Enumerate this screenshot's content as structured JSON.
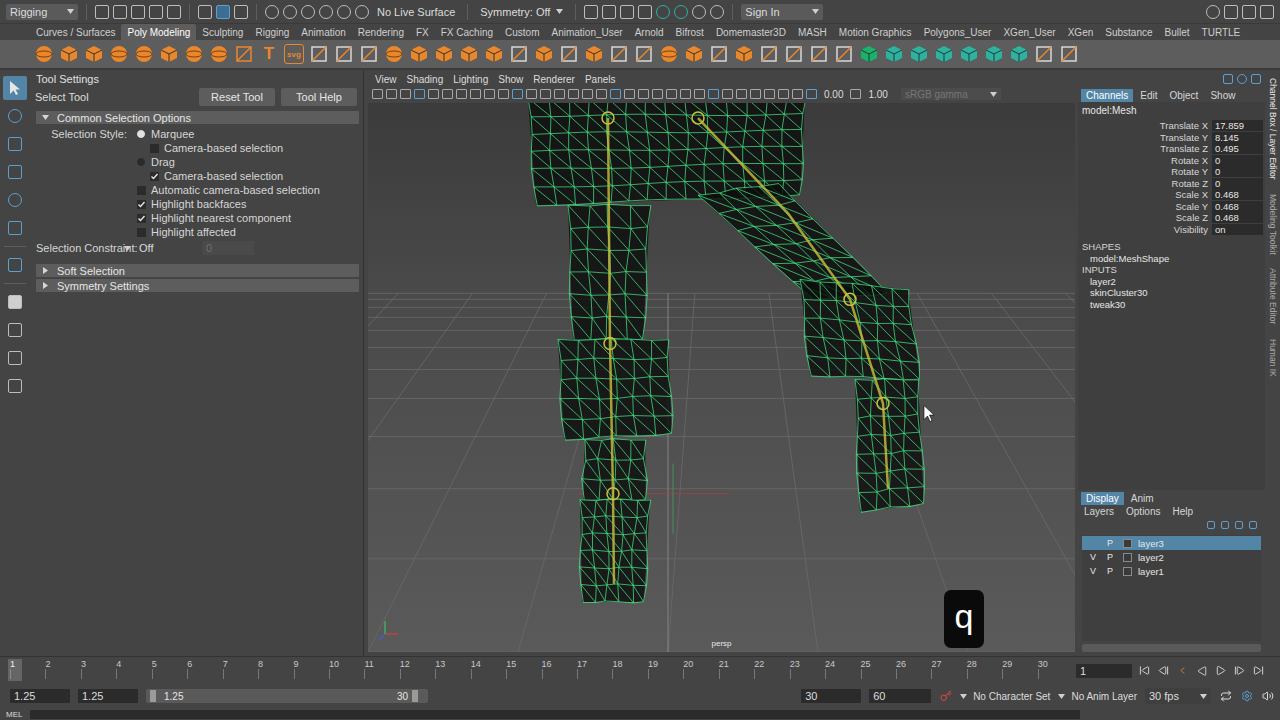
{
  "workspace": {
    "label": "Rigging"
  },
  "status_line": {
    "live_surface": "No Live Surface",
    "symmetry": "Symmetry: Off",
    "sign_in": "Sign In"
  },
  "shelf_tabs": [
    {
      "label": "Curves / Surfaces",
      "selected": false
    },
    {
      "label": "Poly Modeling",
      "selected": true
    },
    {
      "label": "Sculpting",
      "selected": false
    },
    {
      "label": "Rigging",
      "selected": false
    },
    {
      "label": "Animation",
      "selected": false
    },
    {
      "label": "Rendering",
      "selected": false
    },
    {
      "label": "FX",
      "selected": false
    },
    {
      "label": "FX Caching",
      "selected": false
    },
    {
      "label": "Custom",
      "selected": false
    },
    {
      "label": "Animation_User",
      "selected": false
    },
    {
      "label": "Arnold",
      "selected": false
    },
    {
      "label": "Bifrost",
      "selected": false
    },
    {
      "label": "Domemaster3D",
      "selected": false
    },
    {
      "label": "MASH",
      "selected": false
    },
    {
      "label": "Motion Graphics",
      "selected": false
    },
    {
      "label": "Polygons_User",
      "selected": false
    },
    {
      "label": "XGen_User",
      "selected": false
    },
    {
      "label": "XGen",
      "selected": false
    },
    {
      "label": "Substance",
      "selected": false
    },
    {
      "label": "Bullet",
      "selected": false
    },
    {
      "label": "TURTLE",
      "selected": false
    }
  ],
  "shelf_icons": [
    {
      "kind": "sphere",
      "color": "#e8872c"
    },
    {
      "kind": "cube",
      "color": "#e8872c"
    },
    {
      "kind": "cube",
      "color": "#e8872c"
    },
    {
      "kind": "sphere",
      "color": "#e8872c"
    },
    {
      "kind": "sphere",
      "color": "#e8872c"
    },
    {
      "kind": "cube",
      "color": "#e8872c"
    },
    {
      "kind": "sphere",
      "color": "#e8872c"
    },
    {
      "kind": "sphere",
      "color": "#e8872c"
    },
    {
      "kind": "tool",
      "color": "#e8872c"
    },
    {
      "kind": "text",
      "text": "T",
      "color": "#e8872c"
    },
    {
      "kind": "text",
      "text": "svg",
      "color": "#e8872c"
    },
    {
      "kind": "tool",
      "color": "#d8d8d8"
    },
    {
      "kind": "tool",
      "color": "#d8d8d8"
    },
    {
      "kind": "tool",
      "color": "#d8d8d8"
    },
    {
      "kind": "sphere",
      "color": "#e8872c"
    },
    {
      "kind": "cube",
      "color": "#e8872c"
    },
    {
      "kind": "cube",
      "color": "#e8872c"
    },
    {
      "kind": "cube",
      "color": "#e8872c"
    },
    {
      "kind": "cube",
      "color": "#e8872c"
    },
    {
      "kind": "tool",
      "color": "#d8d8d8"
    },
    {
      "kind": "cube",
      "color": "#e8872c"
    },
    {
      "kind": "tool",
      "color": "#d8d8d8"
    },
    {
      "kind": "cube",
      "color": "#e8872c"
    },
    {
      "kind": "tool",
      "color": "#d8d8d8"
    },
    {
      "kind": "tool",
      "color": "#d8d8d8"
    },
    {
      "kind": "sphere",
      "color": "#e8872c"
    },
    {
      "kind": "cube",
      "color": "#e8872c"
    },
    {
      "kind": "tool",
      "color": "#d8d8d8"
    },
    {
      "kind": "cube",
      "color": "#e8872c"
    },
    {
      "kind": "tool",
      "color": "#d8d8d8"
    },
    {
      "kind": "tool",
      "color": "#d8d8d8"
    },
    {
      "kind": "tool",
      "color": "#d8d8d8"
    },
    {
      "kind": "tool",
      "color": "#d8d8d8"
    },
    {
      "kind": "cube",
      "color": "#18b36b"
    },
    {
      "kind": "cube",
      "color": "#2bb3a0"
    },
    {
      "kind": "cube",
      "color": "#2bb3a0"
    },
    {
      "kind": "cube",
      "color": "#2bb3a0"
    },
    {
      "kind": "cube",
      "color": "#2bb3a0"
    },
    {
      "kind": "cube",
      "color": "#2bb3a0"
    },
    {
      "kind": "cube",
      "color": "#2bb3a0"
    },
    {
      "kind": "tool",
      "color": "#d8d8d8"
    },
    {
      "kind": "tool",
      "color": "#d8d8d8"
    }
  ],
  "tool_settings": {
    "title": "Tool Settings",
    "tool_name": "Select Tool",
    "buttons": [
      "Reset Tool",
      "Tool Help"
    ],
    "sections": [
      {
        "label": "Common Selection Options",
        "expanded": true
      },
      {
        "label": "Soft Selection",
        "expanded": false
      },
      {
        "label": "Symmetry Settings",
        "expanded": false
      }
    ],
    "selection_style_label": "Selection Style:",
    "options": [
      {
        "kind": "radio",
        "label": "Marquee",
        "checked": true
      },
      {
        "kind": "subcheck",
        "label": "Camera-based selection",
        "checked": false
      },
      {
        "kind": "radio",
        "label": "Drag",
        "checked": false
      },
      {
        "kind": "subcheck",
        "label": "Camera-based selection",
        "checked": true
      },
      {
        "kind": "check",
        "label": "Automatic camera-based selection",
        "checked": false
      },
      {
        "kind": "check",
        "label": "Highlight backfaces",
        "checked": true
      },
      {
        "kind": "check",
        "label": "Highlight nearest component",
        "checked": true
      },
      {
        "kind": "check",
        "label": "Highlight affected",
        "checked": false
      }
    ],
    "constraint": {
      "label": "Selection Constraint:",
      "value": "Off",
      "number": "0",
      "number_disabled": true
    }
  },
  "viewport": {
    "menus": [
      "View",
      "Shading",
      "Lighting",
      "Show",
      "Renderer",
      "Panels"
    ],
    "exposure": "0.00",
    "gamma": "1.00",
    "color_space": "sRGB gamma",
    "camera": "persp"
  },
  "key_overlay": "q",
  "channel_box": {
    "tabs": [
      {
        "label": "Channels",
        "selected": true
      },
      {
        "label": "Edit",
        "selected": false
      },
      {
        "label": "Object",
        "selected": false
      },
      {
        "label": "Show",
        "selected": false
      }
    ],
    "object": "model:Mesh",
    "attributes": [
      {
        "label": "Translate X",
        "value": "17.859"
      },
      {
        "label": "Translate Y",
        "value": "8.145"
      },
      {
        "label": "Translate Z",
        "value": "0.495"
      },
      {
        "label": "Rotate X",
        "value": "0"
      },
      {
        "label": "Rotate Y",
        "value": "0"
      },
      {
        "label": "Rotate Z",
        "value": "0"
      },
      {
        "label": "Scale X",
        "value": "0.468"
      },
      {
        "label": "Scale Y",
        "value": "0.468"
      },
      {
        "label": "Scale Z",
        "value": "0.468"
      },
      {
        "label": "Visibility",
        "value": "on"
      }
    ],
    "shapes_label": "SHAPES",
    "shapes": [
      "model:MeshShape"
    ],
    "inputs_label": "INPUTS",
    "inputs": [
      "layer2",
      "skinCluster30",
      "tweak30"
    ]
  },
  "side_tabs": [
    {
      "label": "Channel Box / Layer Editor",
      "selected": true
    },
    {
      "label": "Modeling Toolkit",
      "selected": false
    },
    {
      "label": "Attribute Editor",
      "selected": false
    },
    {
      "label": "Human IK",
      "selected": false
    }
  ],
  "layer_editor": {
    "tabs": [
      {
        "label": "Display",
        "selected": true
      },
      {
        "label": "Anim",
        "selected": false
      }
    ],
    "menus": [
      "Layers",
      "Options",
      "Help"
    ],
    "visible_mark": "V",
    "playback_mark": "P",
    "layers": [
      {
        "name": "layer3",
        "visible": false,
        "playback": true,
        "selected": true
      },
      {
        "name": "layer2",
        "visible": true,
        "playback": true,
        "selected": false
      },
      {
        "name": "layer1",
        "visible": true,
        "playback": true,
        "selected": false
      }
    ]
  },
  "timeline": {
    "ticks": [
      "1",
      "2",
      "3",
      "4",
      "5",
      "6",
      "7",
      "8",
      "9",
      "10",
      "11",
      "12",
      "13",
      "14",
      "15",
      "16",
      "17",
      "18",
      "19",
      "20",
      "21",
      "22",
      "23",
      "24",
      "25",
      "26",
      "27",
      "28",
      "29",
      "30"
    ],
    "current_time": "1"
  },
  "range_slider": {
    "start": "1.25",
    "range_start": "1.25",
    "bar_start": "1.25",
    "bar_end": "30",
    "range_end": "30",
    "end": "60",
    "character_set": "No Character Set",
    "anim_layer": "No Anim Layer",
    "fps": "30 fps"
  },
  "command_line": "MEL"
}
